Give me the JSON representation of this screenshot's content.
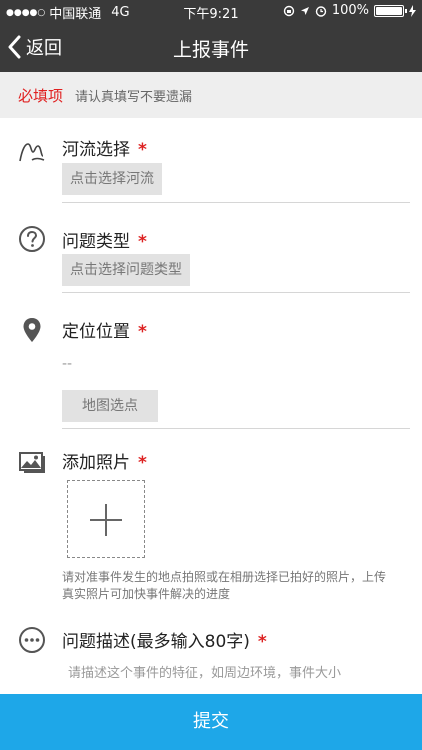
{
  "status_bar": {
    "signal": "●●●●○",
    "carrier": "中国联通",
    "network": "4G",
    "time": "下午9:21",
    "battery": "100%"
  },
  "nav": {
    "back_label": "返回",
    "title": "上报事件"
  },
  "banner": {
    "required_label": "必填项",
    "hint": "请认真填写不要遗漏"
  },
  "form": {
    "river": {
      "label": "河流选择",
      "star": "*",
      "button": "点击选择河流"
    },
    "issue_type": {
      "label": "问题类型",
      "star": "*",
      "button": "点击选择问题类型"
    },
    "location": {
      "label": "定位位置",
      "star": "*",
      "value": "--",
      "button": "地图选点"
    },
    "photo": {
      "label": "添加照片",
      "star": "*",
      "note": "请对准事件发生的地点拍照或在相册选择已拍好的照片，上传真实照片可加快事件解决的进度"
    },
    "description": {
      "label": "问题描述(最多输入80字)",
      "star": "*",
      "placeholder": "请描述这个事件的特征，如周边环境，事件大小"
    }
  },
  "submit_label": "提交",
  "colors": {
    "header": "#3a3a3a",
    "required": "#e02020",
    "submit": "#1ea7e8"
  }
}
